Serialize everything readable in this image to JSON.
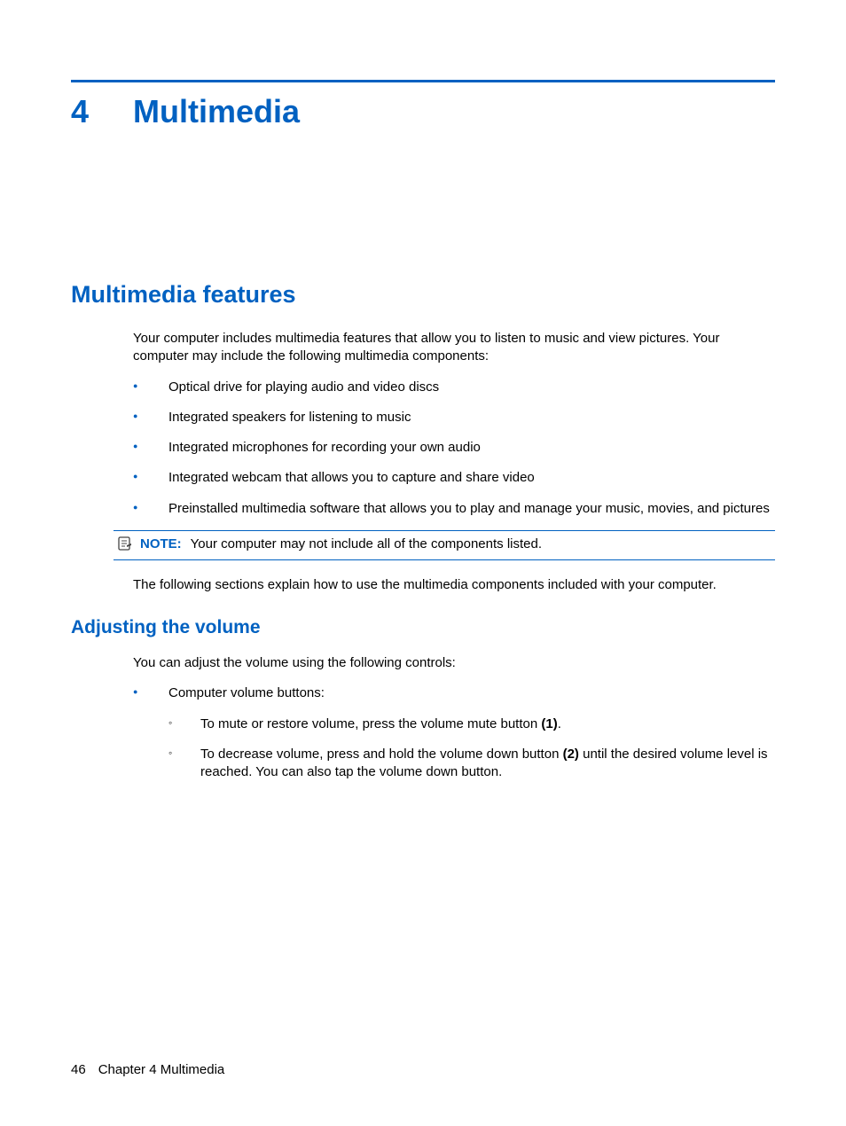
{
  "chapter": {
    "number": "4",
    "title": "Multimedia"
  },
  "section1": {
    "heading": "Multimedia features",
    "intro": "Your computer includes multimedia features that allow you to listen to music and view pictures. Your computer may include the following multimedia components:",
    "bullets": [
      "Optical drive for playing audio and video discs",
      "Integrated speakers for listening to music",
      "Integrated microphones for recording your own audio",
      "Integrated webcam that allows you to capture and share video",
      "Preinstalled multimedia software that allows you to play and manage your music, movies, and pictures"
    ],
    "note": {
      "label": "NOTE:",
      "text": "Your computer may not include all of the components listed."
    },
    "after_note": "The following sections explain how to use the multimedia components included with your computer."
  },
  "section2": {
    "heading": "Adjusting the volume",
    "intro": "You can adjust the volume using the following controls:",
    "bullet1": "Computer volume buttons:",
    "sub1_pre": "To mute or restore volume, press the volume mute button ",
    "sub1_bold": "(1)",
    "sub1_post": ".",
    "sub2_pre": "To decrease volume, press and hold the volume down button ",
    "sub2_bold": "(2)",
    "sub2_post": " until the desired volume level is reached. You can also tap the volume down button."
  },
  "footer": {
    "page": "46",
    "chapter_label": "Chapter 4   Multimedia"
  }
}
